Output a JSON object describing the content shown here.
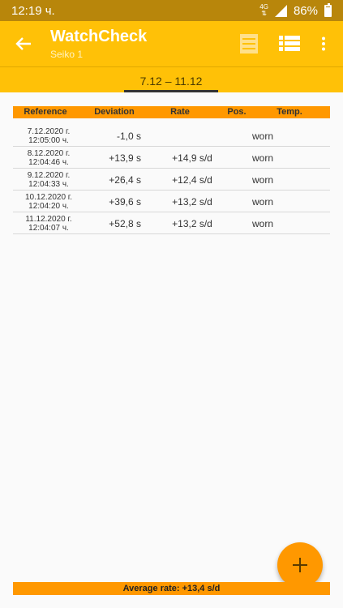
{
  "status_bar": {
    "time": "12:19 ч.",
    "network": "4G",
    "battery": "86%"
  },
  "app_bar": {
    "title": "WatchCheck",
    "subtitle": "Seiko 1"
  },
  "tab": {
    "label": "7.12 – 11.12"
  },
  "table": {
    "headers": {
      "reference": "Reference",
      "deviation": "Deviation",
      "rate": "Rate",
      "pos": "Pos.",
      "temp": "Temp."
    },
    "rows": [
      {
        "date": "7.12.2020 г.",
        "time": "12:05:00 ч.",
        "deviation": "-1,0 s",
        "rate": "",
        "pos": "worn"
      },
      {
        "date": "8.12.2020 г.",
        "time": "12:04:46 ч.",
        "deviation": "+13,9 s",
        "rate": "+14,9 s/d",
        "pos": "worn"
      },
      {
        "date": "9.12.2020 г.",
        "time": "12:04:33 ч.",
        "deviation": "+26,4 s",
        "rate": "+12,4 s/d",
        "pos": "worn"
      },
      {
        "date": "10.12.2020 г.",
        "time": "12:04:20 ч.",
        "deviation": "+39,6 s",
        "rate": "+13,2 s/d",
        "pos": "worn"
      },
      {
        "date": "11.12.2020 г.",
        "time": "12:04:07 ч.",
        "deviation": "+52,8 s",
        "rate": "+13,2 s/d",
        "pos": "worn"
      }
    ]
  },
  "footer": {
    "average": "Average rate: +13,4 s/d"
  },
  "icons": {
    "back": "arrow-back-icon",
    "card_view": "card-view-icon",
    "list_view": "list-view-icon",
    "menu": "more-vert-icon",
    "add": "plus-icon"
  },
  "colors": {
    "status_bar": "#b8860b",
    "app_bar": "#ffc107",
    "accent": "#ff9800"
  }
}
